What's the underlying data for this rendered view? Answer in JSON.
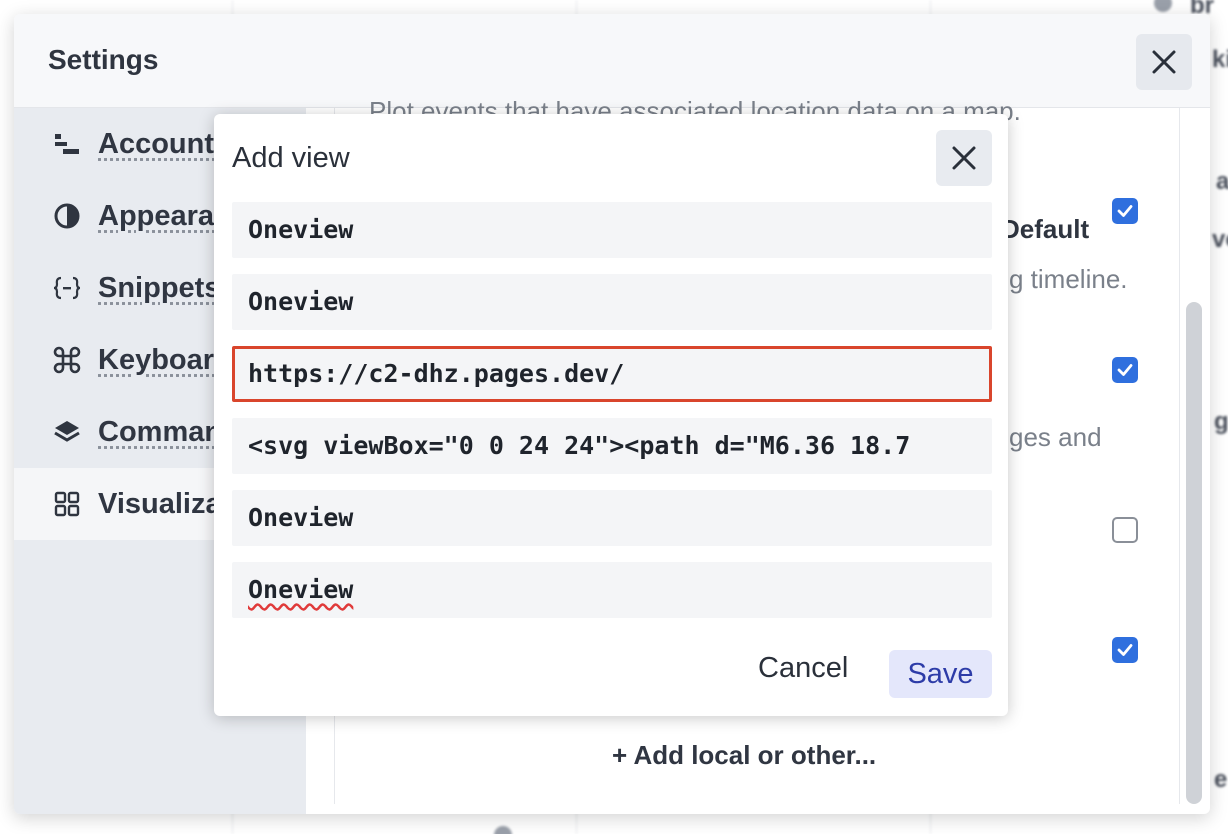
{
  "background": {
    "fragments": [
      "br",
      "ki",
      "a",
      "vo",
      "g",
      "e"
    ]
  },
  "settings": {
    "title": "Settings",
    "sidebar": [
      {
        "label": "Account",
        "icon": "account-icon"
      },
      {
        "label": "Appearance",
        "icon": "appearance-icon"
      },
      {
        "label": "Snippets",
        "icon": "snippets-icon"
      },
      {
        "label": "Keyboard",
        "icon": "keyboard-icon"
      },
      {
        "label": "Commands",
        "icon": "commands-icon"
      },
      {
        "label": "Visualizations",
        "icon": "visualizations-icon"
      }
    ],
    "content": {
      "top_text": "Plot events that have associated location data on a map.",
      "default_label": "Default",
      "timeline_text": "g timeline.",
      "pages_text": "ges and",
      "add_local": "+ Add local or other..."
    },
    "checkboxes": [
      true,
      true,
      false,
      true
    ]
  },
  "dialog": {
    "title": "Add view",
    "fields": [
      {
        "value": "Oneview",
        "focused": false
      },
      {
        "value": "Oneview",
        "focused": false
      },
      {
        "value": "https://c2-dhz.pages.dev/",
        "focused": true
      },
      {
        "value": "<svg viewBox=\"0 0 24 24\"><path d=\"M6.36 18.7",
        "focused": false
      },
      {
        "value": "Oneview",
        "focused": false
      },
      {
        "value": "Oneview",
        "focused": false,
        "spellcheck_error": true
      }
    ],
    "cancel_label": "Cancel",
    "save_label": "Save"
  },
  "colors": {
    "accent": "#2f6fde",
    "focus_border": "#d9452c",
    "save_bg": "#e4e7fb",
    "save_text": "#2d3ca8"
  }
}
